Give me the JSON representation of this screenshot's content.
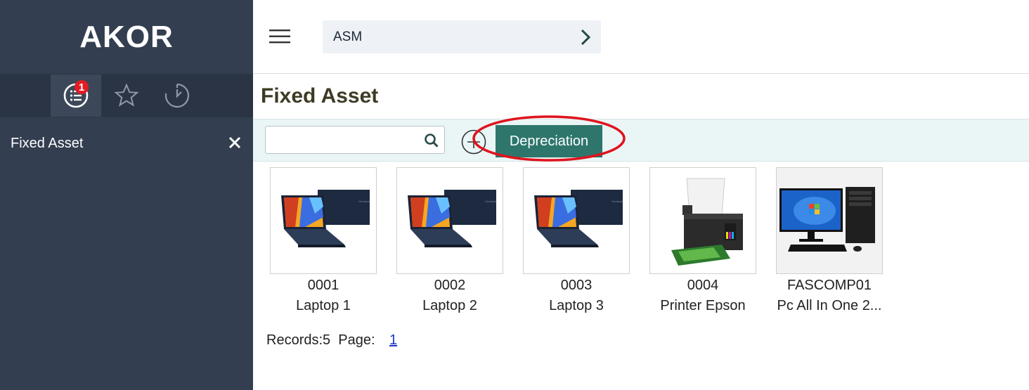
{
  "sidebar": {
    "brand": "AKOR",
    "tabs": [
      {
        "icon": "list-icon",
        "badge": "1",
        "active": true
      },
      {
        "icon": "star-icon"
      },
      {
        "icon": "history-icon"
      }
    ],
    "open_item": {
      "label": "Fixed Asset",
      "close_icon": "close-icon"
    }
  },
  "topbar": {
    "menu_icon": "hamburger-icon",
    "breadcrumb": "ASM",
    "arrow_icon": "chevron-right-icon"
  },
  "page": {
    "title": "Fixed Asset"
  },
  "toolbar": {
    "search_value": "",
    "search_icon": "search-icon",
    "add_icon": "plus-circle-icon",
    "depreciation_label": "Depreciation",
    "highlight_color": "#e0141e"
  },
  "assets": [
    {
      "code": "0001",
      "name": "Laptop 1",
      "image": "laptop"
    },
    {
      "code": "0002",
      "name": "Laptop 2",
      "image": "laptop"
    },
    {
      "code": "0003",
      "name": "Laptop 3",
      "image": "laptop"
    },
    {
      "code": "0004",
      "name": "Printer Epson",
      "image": "printer"
    },
    {
      "code": "FASCOMP01",
      "name": "Pc All In One 2...",
      "image": "desktop-pc"
    }
  ],
  "footer": {
    "records": "Records:5  Page:",
    "page": "1"
  },
  "colors": {
    "sidebar": "#333e50",
    "accent": "#2e766c",
    "toolbar_bg": "#eaf6f6",
    "title": "#3e3b25"
  }
}
